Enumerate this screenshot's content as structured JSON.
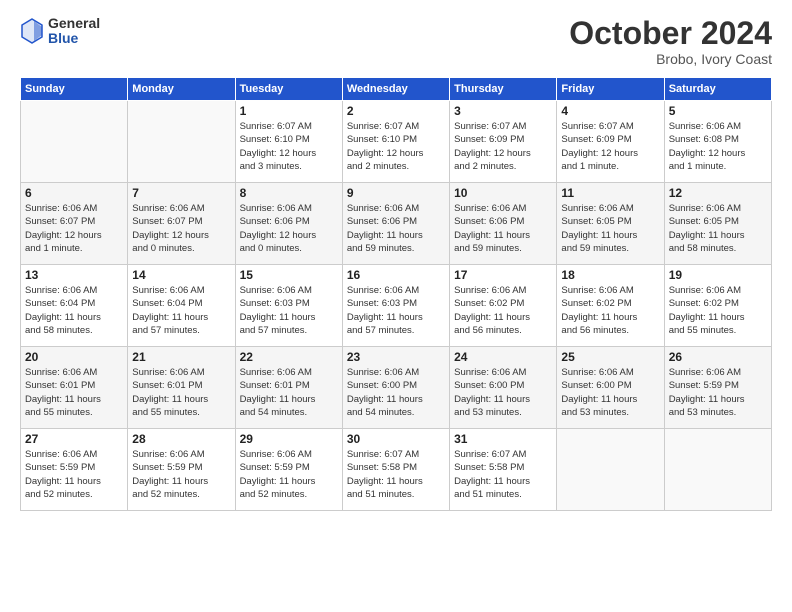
{
  "header": {
    "logo_general": "General",
    "logo_blue": "Blue",
    "month": "October 2024",
    "location": "Brobo, Ivory Coast"
  },
  "weekdays": [
    "Sunday",
    "Monday",
    "Tuesday",
    "Wednesday",
    "Thursday",
    "Friday",
    "Saturday"
  ],
  "weeks": [
    [
      {
        "day": "",
        "info": ""
      },
      {
        "day": "",
        "info": ""
      },
      {
        "day": "1",
        "info": "Sunrise: 6:07 AM\nSunset: 6:10 PM\nDaylight: 12 hours\nand 3 minutes."
      },
      {
        "day": "2",
        "info": "Sunrise: 6:07 AM\nSunset: 6:10 PM\nDaylight: 12 hours\nand 2 minutes."
      },
      {
        "day": "3",
        "info": "Sunrise: 6:07 AM\nSunset: 6:09 PM\nDaylight: 12 hours\nand 2 minutes."
      },
      {
        "day": "4",
        "info": "Sunrise: 6:07 AM\nSunset: 6:09 PM\nDaylight: 12 hours\nand 1 minute."
      },
      {
        "day": "5",
        "info": "Sunrise: 6:06 AM\nSunset: 6:08 PM\nDaylight: 12 hours\nand 1 minute."
      }
    ],
    [
      {
        "day": "6",
        "info": "Sunrise: 6:06 AM\nSunset: 6:07 PM\nDaylight: 12 hours\nand 1 minute."
      },
      {
        "day": "7",
        "info": "Sunrise: 6:06 AM\nSunset: 6:07 PM\nDaylight: 12 hours\nand 0 minutes."
      },
      {
        "day": "8",
        "info": "Sunrise: 6:06 AM\nSunset: 6:06 PM\nDaylight: 12 hours\nand 0 minutes."
      },
      {
        "day": "9",
        "info": "Sunrise: 6:06 AM\nSunset: 6:06 PM\nDaylight: 11 hours\nand 59 minutes."
      },
      {
        "day": "10",
        "info": "Sunrise: 6:06 AM\nSunset: 6:06 PM\nDaylight: 11 hours\nand 59 minutes."
      },
      {
        "day": "11",
        "info": "Sunrise: 6:06 AM\nSunset: 6:05 PM\nDaylight: 11 hours\nand 59 minutes."
      },
      {
        "day": "12",
        "info": "Sunrise: 6:06 AM\nSunset: 6:05 PM\nDaylight: 11 hours\nand 58 minutes."
      }
    ],
    [
      {
        "day": "13",
        "info": "Sunrise: 6:06 AM\nSunset: 6:04 PM\nDaylight: 11 hours\nand 58 minutes."
      },
      {
        "day": "14",
        "info": "Sunrise: 6:06 AM\nSunset: 6:04 PM\nDaylight: 11 hours\nand 57 minutes."
      },
      {
        "day": "15",
        "info": "Sunrise: 6:06 AM\nSunset: 6:03 PM\nDaylight: 11 hours\nand 57 minutes."
      },
      {
        "day": "16",
        "info": "Sunrise: 6:06 AM\nSunset: 6:03 PM\nDaylight: 11 hours\nand 57 minutes."
      },
      {
        "day": "17",
        "info": "Sunrise: 6:06 AM\nSunset: 6:02 PM\nDaylight: 11 hours\nand 56 minutes."
      },
      {
        "day": "18",
        "info": "Sunrise: 6:06 AM\nSunset: 6:02 PM\nDaylight: 11 hours\nand 56 minutes."
      },
      {
        "day": "19",
        "info": "Sunrise: 6:06 AM\nSunset: 6:02 PM\nDaylight: 11 hours\nand 55 minutes."
      }
    ],
    [
      {
        "day": "20",
        "info": "Sunrise: 6:06 AM\nSunset: 6:01 PM\nDaylight: 11 hours\nand 55 minutes."
      },
      {
        "day": "21",
        "info": "Sunrise: 6:06 AM\nSunset: 6:01 PM\nDaylight: 11 hours\nand 55 minutes."
      },
      {
        "day": "22",
        "info": "Sunrise: 6:06 AM\nSunset: 6:01 PM\nDaylight: 11 hours\nand 54 minutes."
      },
      {
        "day": "23",
        "info": "Sunrise: 6:06 AM\nSunset: 6:00 PM\nDaylight: 11 hours\nand 54 minutes."
      },
      {
        "day": "24",
        "info": "Sunrise: 6:06 AM\nSunset: 6:00 PM\nDaylight: 11 hours\nand 53 minutes."
      },
      {
        "day": "25",
        "info": "Sunrise: 6:06 AM\nSunset: 6:00 PM\nDaylight: 11 hours\nand 53 minutes."
      },
      {
        "day": "26",
        "info": "Sunrise: 6:06 AM\nSunset: 5:59 PM\nDaylight: 11 hours\nand 53 minutes."
      }
    ],
    [
      {
        "day": "27",
        "info": "Sunrise: 6:06 AM\nSunset: 5:59 PM\nDaylight: 11 hours\nand 52 minutes."
      },
      {
        "day": "28",
        "info": "Sunrise: 6:06 AM\nSunset: 5:59 PM\nDaylight: 11 hours\nand 52 minutes."
      },
      {
        "day": "29",
        "info": "Sunrise: 6:06 AM\nSunset: 5:59 PM\nDaylight: 11 hours\nand 52 minutes."
      },
      {
        "day": "30",
        "info": "Sunrise: 6:07 AM\nSunset: 5:58 PM\nDaylight: 11 hours\nand 51 minutes."
      },
      {
        "day": "31",
        "info": "Sunrise: 6:07 AM\nSunset: 5:58 PM\nDaylight: 11 hours\nand 51 minutes."
      },
      {
        "day": "",
        "info": ""
      },
      {
        "day": "",
        "info": ""
      }
    ]
  ]
}
